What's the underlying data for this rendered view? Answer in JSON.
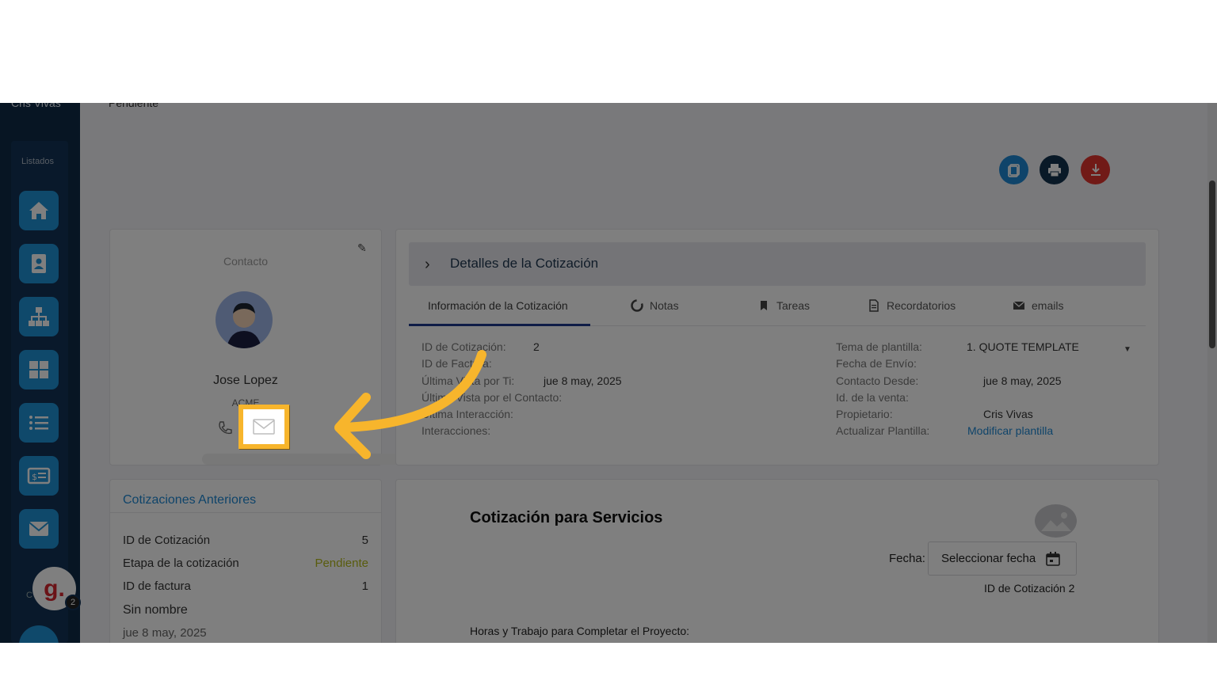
{
  "sidebar": {
    "user_name": "Cris Vivas",
    "section_label": "Listados",
    "nav_icons": [
      "home-icon",
      "contact-card-icon",
      "org-chart-icon",
      "grid-icon",
      "list-icon",
      "invoice-icon",
      "mail-icon"
    ],
    "avatar_letter": "g.",
    "badge_count": "2",
    "collapsed_letter": "C"
  },
  "header": {
    "status_text": "Pendiente",
    "actions": [
      "copy-icon",
      "print-icon",
      "download-icon"
    ]
  },
  "contact": {
    "title": "Contacto",
    "name": "Jose Lopez",
    "company": "ACME"
  },
  "details": {
    "header_title": "Detalles de la Cotización",
    "tabs": [
      {
        "label": "Información de la Cotización",
        "icon": ""
      },
      {
        "label": "Notas",
        "icon": "notes-icon"
      },
      {
        "label": "Tareas",
        "icon": "tasks-icon"
      },
      {
        "label": "Recordatorios",
        "icon": "reminders-icon"
      },
      {
        "label": "emails",
        "icon": "emails-icon"
      }
    ],
    "left_fields": [
      {
        "label": "ID de Cotización:",
        "value": "2"
      },
      {
        "label": "ID de Factura:",
        "value": ""
      },
      {
        "label": "Última Vista por Ti:",
        "value": "jue 8 may, 2025"
      },
      {
        "label": "Última Vista por el Contacto:",
        "value": ""
      },
      {
        "label": "Última Interacción:",
        "value": ""
      },
      {
        "label": "Interacciones:",
        "value": ""
      }
    ],
    "right_fields": [
      {
        "label": "Tema de plantilla:",
        "value": "1. QUOTE TEMPLATE"
      },
      {
        "label": "Fecha de Envío:",
        "value": ""
      },
      {
        "label": "Contacto Desde:",
        "value": "jue 8 may, 2025"
      },
      {
        "label": "Id. de la venta:",
        "value": ""
      },
      {
        "label": "Propietario:",
        "value": "Cris Vivas"
      },
      {
        "label": "Actualizar Plantilla:",
        "value": "Modificar plantilla"
      }
    ]
  },
  "previous_quotes": {
    "title": "Cotizaciones Anteriores",
    "rows": [
      {
        "label": "ID de Cotización",
        "value": "5"
      },
      {
        "label": "Etapa de la cotización",
        "value": "Pendiente"
      },
      {
        "label": "ID de factura",
        "value": "1"
      }
    ],
    "name": "Sin nombre",
    "date": "jue 8 may, 2025"
  },
  "quote": {
    "title": "Cotización para Servicios",
    "date_label": "Fecha:",
    "date_placeholder": "Seleccionar fecha",
    "quote_id_label": "ID de Cotización",
    "quote_id_value": "2",
    "hours_heading": "Horas y Trabajo para Completar el Proyecto:"
  },
  "colors": {
    "sidebar_bg": "#0f2a47",
    "nav_button": "#1e93d6",
    "highlight": "#f7b52c",
    "link": "#1e88d4",
    "pending": "#b3b81a",
    "download_button": "#e3342f"
  }
}
